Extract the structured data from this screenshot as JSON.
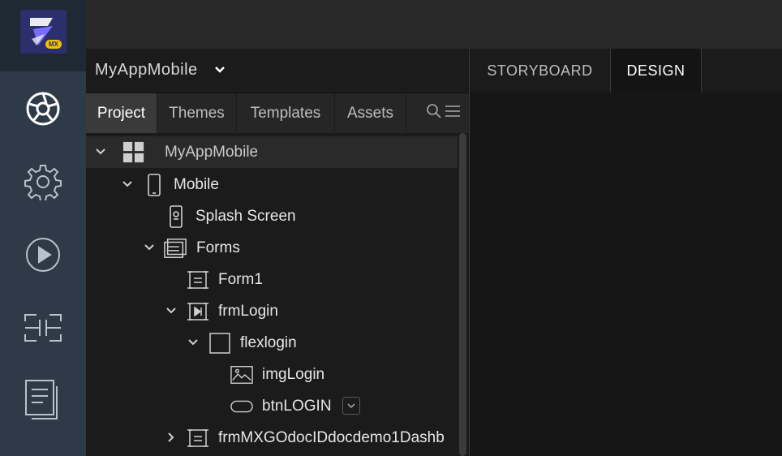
{
  "rail": {
    "logo_badge": "MX",
    "icons": [
      "logo-icon",
      "aperture-icon",
      "gear-icon",
      "play-icon",
      "bracket-icon",
      "document-icon"
    ]
  },
  "header": {
    "app_name": "MyAppMobile"
  },
  "view_tabs": [
    {
      "label": "STORYBOARD"
    },
    {
      "label": "DESIGN",
      "active": true
    }
  ],
  "project_tabs": [
    {
      "label": "Project",
      "active": true
    },
    {
      "label": "Themes"
    },
    {
      "label": "Templates"
    },
    {
      "label": "Assets"
    }
  ],
  "tree": {
    "root": "MyAppMobile",
    "mobile": "Mobile",
    "splash": "Splash Screen",
    "forms": "Forms",
    "form1": "Form1",
    "frmlogin": "frmLogin",
    "flexlogin": "flexlogin",
    "imglogin": "imgLogin",
    "btnlogin": "btnLOGIN",
    "frmdash": "frmMXGOdocIDdocdemo1Dashb"
  },
  "colors": {
    "rail_bg": "#2e3a47",
    "logo_bg": "#2b2f6b",
    "logo_accent": "#f2c200"
  }
}
